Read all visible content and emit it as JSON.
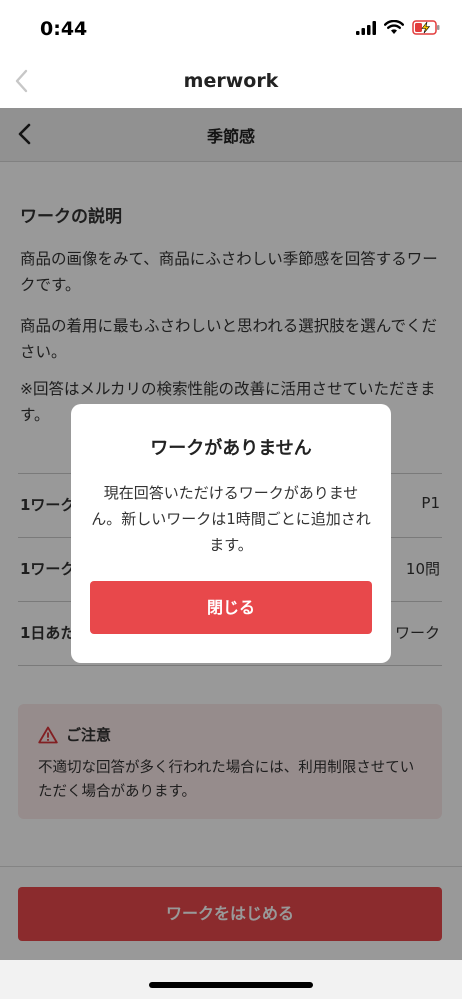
{
  "status_bar": {
    "time": "0:44"
  },
  "app_header": {
    "title": "merwork"
  },
  "nav": {
    "title": "季節感"
  },
  "description": {
    "title": "ワークの説明",
    "paragraphs": [
      "商品の画像をみて、商品にふさわしい季節感を回答するワークです。",
      "商品の着用に最もふさわしいと思われる選択肢を選んでください。",
      "※回答はメルカリの検索性能の改善に活用させていただきます。"
    ]
  },
  "info_rows": [
    {
      "label": "1ワーク",
      "value": "P1"
    },
    {
      "label": "1ワーク",
      "value": "10問"
    },
    {
      "label": "1日あた",
      "value": "ワーク"
    }
  ],
  "notice": {
    "title": "ご注意",
    "text": "不適切な回答が多く行われた場合には、利用制限させていただく場合があります。"
  },
  "start_button": {
    "label": "ワークをはじめる"
  },
  "dialog": {
    "title": "ワークがありません",
    "message": "現在回答いただけるワークがありません。新しいワークは1時間ごとに追加されます。",
    "close_label": "閉じる"
  },
  "colors": {
    "accent": "#e8484b",
    "notice_bg": "#fbe9e9",
    "warning_icon": "#d9343a",
    "battery": "#f2c200"
  }
}
